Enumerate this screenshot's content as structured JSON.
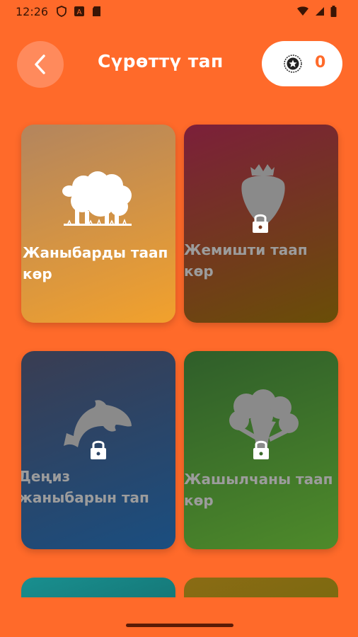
{
  "status_bar": {
    "time": "12:26"
  },
  "header": {
    "title": "Сүрөттү тап",
    "score": "0"
  },
  "cards": [
    {
      "label": "Жаныбарды таап көр",
      "locked": false,
      "icon": "sheep-icon"
    },
    {
      "label": "Жемишти таап көр",
      "locked": true,
      "icon": "strawberry-icon"
    },
    {
      "label": "Деңиз жаныбарын тап",
      "locked": true,
      "icon": "dolphin-icon"
    },
    {
      "label": "Жашылчаны таап көр",
      "locked": true,
      "icon": "broccoli-icon"
    }
  ],
  "colors": {
    "background": "#ff6a2a",
    "locked_text": "#9c9c9c",
    "unlocked_text": "#ffffff"
  }
}
